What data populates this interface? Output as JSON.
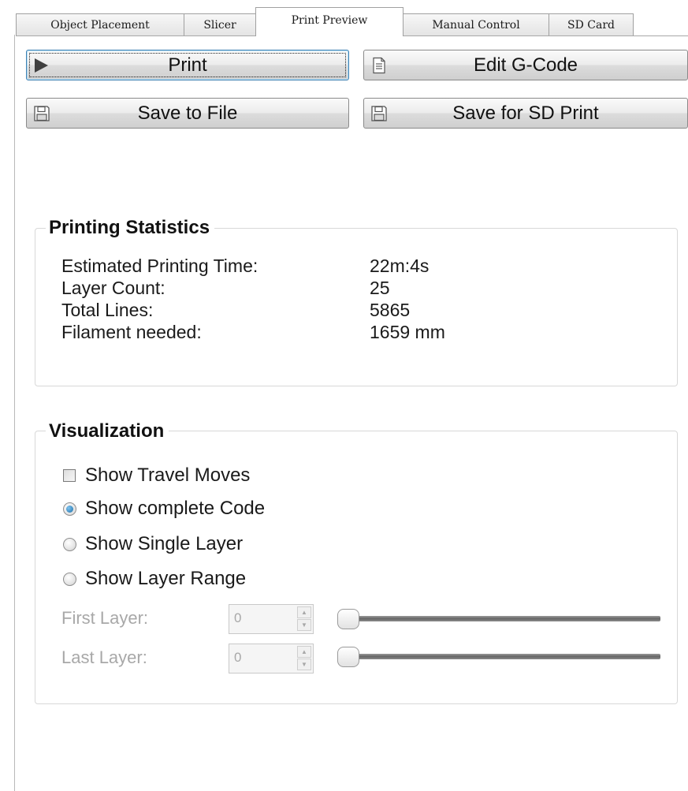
{
  "tabs": [
    {
      "label": "Object Placement",
      "active": false
    },
    {
      "label": "Slicer",
      "active": false
    },
    {
      "label": "Print Preview",
      "active": true
    },
    {
      "label": "Manual Control",
      "active": false
    },
    {
      "label": "SD Card",
      "active": false
    }
  ],
  "buttons": {
    "print": {
      "label": "Print",
      "icon": "play-icon"
    },
    "edit_gcode": {
      "label": "Edit G-Code",
      "icon": "document-icon"
    },
    "save_to_file": {
      "label": "Save to File",
      "icon": "floppy-disk-icon"
    },
    "save_for_sd": {
      "label": "Save for SD Print",
      "icon": "floppy-disk-icon"
    }
  },
  "stats": {
    "title": "Printing Statistics",
    "rows": [
      {
        "label": "Estimated Printing Time:",
        "value": "22m:4s"
      },
      {
        "label": "Layer Count:",
        "value": "25"
      },
      {
        "label": "Total Lines:",
        "value": "5865"
      },
      {
        "label": "Filament needed:",
        "value": "1659 mm"
      }
    ]
  },
  "visualization": {
    "title": "Visualization",
    "show_travel_moves": {
      "label": "Show Travel Moves",
      "checked": false
    },
    "options": [
      {
        "label": "Show complete Code",
        "selected": true
      },
      {
        "label": "Show Single Layer",
        "selected": false
      },
      {
        "label": "Show Layer Range",
        "selected": false
      }
    ],
    "first_layer": {
      "label": "First Layer:",
      "value": "0",
      "slider_fraction": 0
    },
    "last_layer": {
      "label": "Last Layer:",
      "value": "0",
      "slider_fraction": 0
    }
  },
  "colors": {
    "accent": "#1d6fa8",
    "disabled_text": "#a8a8a8",
    "border": "#d8d8d8"
  }
}
